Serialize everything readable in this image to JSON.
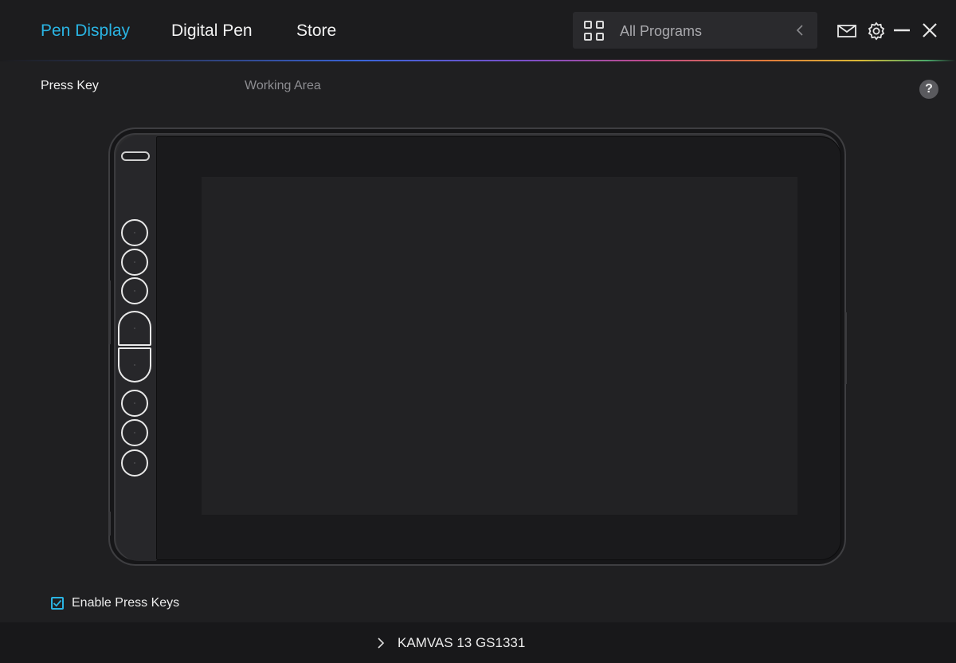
{
  "header": {
    "tabs": [
      {
        "label": "Pen Display",
        "active": true
      },
      {
        "label": "Digital Pen",
        "active": false
      },
      {
        "label": "Store",
        "active": false
      }
    ],
    "program_select": {
      "label": "All Programs",
      "icon": "grid-icon"
    },
    "actions": {
      "mail_icon": "mail-icon",
      "settings_icon": "gear-icon",
      "minimize_icon": "minimize-icon",
      "close_icon": "close-icon"
    }
  },
  "subtabs": [
    {
      "label": "Press Key",
      "active": true
    },
    {
      "label": "Working Area",
      "active": false
    }
  ],
  "help": {
    "label": "?"
  },
  "tablet": {
    "press_key_count": 9
  },
  "enable_press_keys": {
    "label": "Enable Press Keys",
    "checked": true
  },
  "footer": {
    "device": "KAMVAS 13 GS1331"
  },
  "colors": {
    "accent": "#2ab4e3",
    "background": "#1f1f21"
  }
}
